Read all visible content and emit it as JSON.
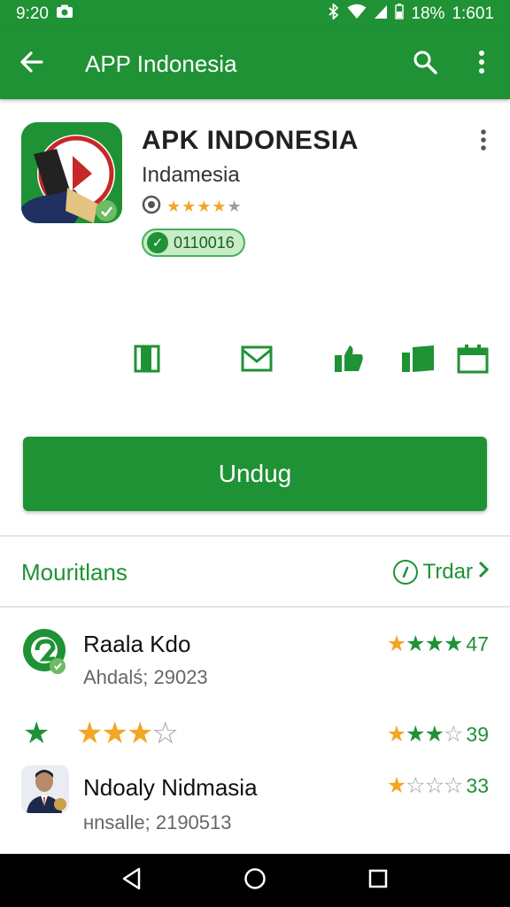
{
  "status_bar": {
    "time": "9:20",
    "battery": "18%",
    "right_time": "1:601",
    "icons": [
      "camera-icon",
      "bluetooth-icon",
      "wifi-icon",
      "signal-icon",
      "battery-icon"
    ]
  },
  "app_bar": {
    "title": "APP Indonesia",
    "icons": [
      "back-arrow-icon",
      "search-icon",
      "more-vert-icon"
    ]
  },
  "app": {
    "title": "APK INDONESIA",
    "developer": "Indamesia",
    "rating_stars": 4,
    "badge": "0110016"
  },
  "actions": {
    "icons": [
      "book-icon",
      "mail-icon",
      "thumbs-up-icon",
      "flag-icon",
      "calendar-icon"
    ]
  },
  "download_button": "Undug",
  "section": {
    "title": "Mouritlans",
    "link": "Trdar"
  },
  "list": [
    {
      "title": "Raala Kdo",
      "subtitle": "Ahdalś; 29023",
      "rating_value": "47"
    },
    {
      "title": "",
      "subtitle": "",
      "rating_value": "39"
    },
    {
      "title": "Ndoaly Nidmasia",
      "subtitle": "ʜnsalle; 2190513",
      "rating_value": "33"
    }
  ],
  "colors": {
    "primary": "#1f9235",
    "star_orange": "#f2a624",
    "badge_bg": "#c8ecc8"
  }
}
